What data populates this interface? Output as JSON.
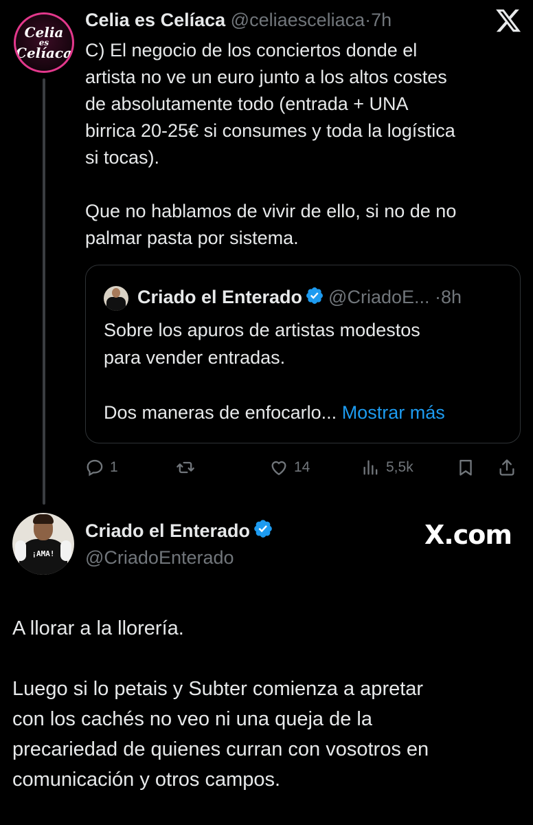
{
  "tweet": {
    "avatar_text": [
      "Celia",
      "es",
      "Celíaca"
    ],
    "author_name": "Celia es Celíaca",
    "handle": "@celiaesceliaca",
    "separator": "·",
    "time": "7h",
    "close_icon": "x-logo-icon",
    "body": "C) El negocio de los conciertos donde el\nartista no ve un euro junto a los altos costes\nde absolutamente todo (entrada + UNA\nbirrica  20-25€ si consumes y toda la logística\nsi tocas).\n\nQue no hablamos de vivir de ello, si no de no\npalmar pasta por sistema.",
    "quote": {
      "author_name": "Criado el Enterado",
      "handle": "@CriadoE...",
      "separator": "·",
      "time": "8h",
      "body": "Sobre los apuros de artistas modestos\npara vender entradas.\n\nDos maneras de enfocarlo... ",
      "show_more": "Mostrar más"
    },
    "actions": {
      "reply_count": "1",
      "retweet_count": "",
      "like_count": "14",
      "views_count": "5,5k"
    }
  },
  "reply": {
    "avatar_print": "¡AMA!",
    "author_name": "Criado el Enterado",
    "handle": "@CriadoEnterado",
    "watermark": "X.com",
    "body": "A llorar a la llorería.\n\nLuego si lo petais y Subter comienza a apretar\ncon los cachés no veo ni una queja de la\nprecariedad de quienes curran con vosotros en\ncomunicación y otros campos."
  },
  "colors": {
    "background": "#000000",
    "text": "#e7e9ea",
    "muted": "#71767b",
    "link": "#1d9bf0",
    "verified": "#1d9bf0",
    "border": "#2f3336",
    "avatar_ring": "#e3388c"
  }
}
